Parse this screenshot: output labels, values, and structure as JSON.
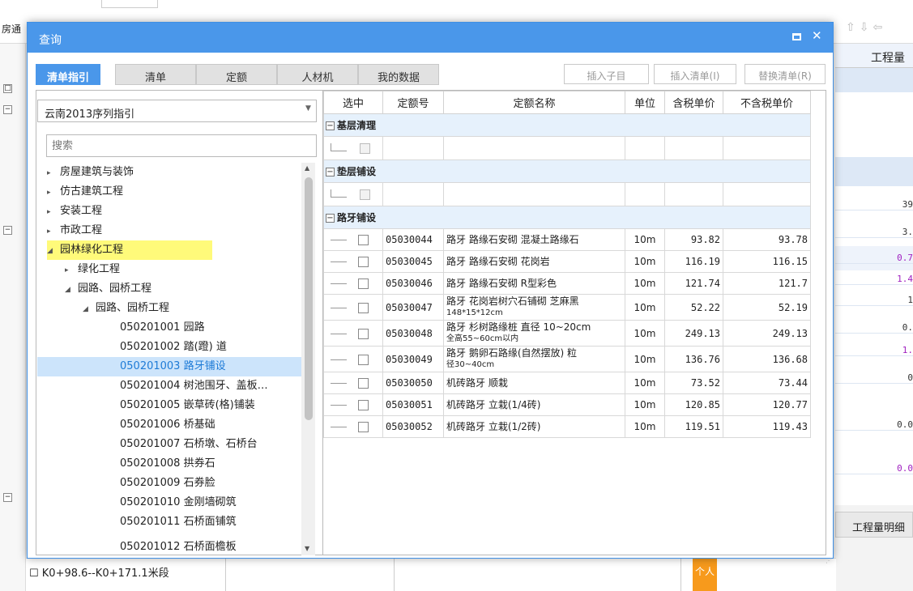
{
  "background": {
    "left_label": "房通",
    "right_header": "工程量",
    "right_values": [
      "39",
      "3.",
      "0.7",
      "1.4",
      "1",
      "0.",
      "1.",
      "0",
      "0.0",
      "0.0"
    ],
    "detail_tab": "工程量明细",
    "bottom_text": "☐ K0+98.6--K0+171.1米段",
    "orange_text": "个人"
  },
  "dialog": {
    "title": "查询",
    "tabs": [
      "清单指引",
      "清单",
      "定额",
      "人材机",
      "我的数据"
    ],
    "toolbar": {
      "insert_child": "插入子目",
      "insert_list": "插入清单(I)",
      "replace_list": "替换清单(R)"
    }
  },
  "left": {
    "index_select": "云南2013序列指引",
    "search_placeholder": "搜索",
    "tree": [
      {
        "label": "房屋建筑与装饰",
        "caret": "▸"
      },
      {
        "label": "仿古建筑工程",
        "caret": "▸"
      },
      {
        "label": "安装工程",
        "caret": "▸"
      },
      {
        "label": "市政工程",
        "caret": "▸"
      },
      {
        "label": "园林绿化工程",
        "caret": "◢"
      },
      {
        "label": "绿化工程",
        "caret": "▸"
      },
      {
        "label": "园路、园桥工程",
        "caret": "◢"
      },
      {
        "label": "园路、园桥工程",
        "caret": "◢"
      },
      {
        "label": "050201001  园路",
        "caret": ""
      },
      {
        "label": "050201002  踏(蹬) 道",
        "caret": ""
      },
      {
        "label": "050201003  路牙铺设",
        "caret": ""
      },
      {
        "label": "050201004  树池围牙、盖板…",
        "caret": ""
      },
      {
        "label": "050201005  嵌草砖(格)铺装",
        "caret": ""
      },
      {
        "label": "050201006  桥基础",
        "caret": ""
      },
      {
        "label": "050201007  石桥墩、石桥台",
        "caret": ""
      },
      {
        "label": "050201008  拱券石",
        "caret": ""
      },
      {
        "label": "050201009  石券脸",
        "caret": ""
      },
      {
        "label": "050201010  金刚墙砌筑",
        "caret": ""
      },
      {
        "label": "050201011  石桥面铺筑",
        "caret": ""
      },
      {
        "label": "050201012  石桥面檐板",
        "caret": ""
      }
    ]
  },
  "grid": {
    "headers": [
      "选中",
      "定额号",
      "定额名称",
      "单位",
      "含税单价",
      "不含税单价"
    ],
    "groups": [
      {
        "title": "基层清理",
        "items": []
      },
      {
        "title": "垫层铺设",
        "items": []
      },
      {
        "title": "路牙铺设",
        "items": [
          {
            "code": "05030044",
            "name": "路牙 路缘石安砌 混凝土路缘石",
            "name2": "",
            "unit": "10m",
            "tax": "93.82",
            "notax": "93.78"
          },
          {
            "code": "05030045",
            "name": "路牙 路缘石安砌 花岗岩",
            "name2": "",
            "unit": "10m",
            "tax": "116.19",
            "notax": "116.15"
          },
          {
            "code": "05030046",
            "name": "路牙 路缘石安砌 R型彩色",
            "name2": "",
            "unit": "10m",
            "tax": "121.74",
            "notax": "121.7"
          },
          {
            "code": "05030047",
            "name": "路牙 花岗岩树穴石铺砌 芝麻黑",
            "name2": "148*15*12cm",
            "unit": "10m",
            "tax": "52.22",
            "notax": "52.19"
          },
          {
            "code": "05030048",
            "name": "路牙 杉树路缘桩 直径 10~20cm",
            "name2": "全高55~60cm以内",
            "unit": "10m",
            "tax": "249.13",
            "notax": "249.13"
          },
          {
            "code": "05030049",
            "name": "路牙 鹅卵石路缘(自然摆放) 粒",
            "name2": "径30~40cm",
            "unit": "10m",
            "tax": "136.76",
            "notax": "136.68"
          },
          {
            "code": "05030050",
            "name": "机砖路牙 顺栽",
            "name2": "",
            "unit": "10m",
            "tax": "73.52",
            "notax": "73.44"
          },
          {
            "code": "05030051",
            "name": "机砖路牙 立栽(1/4砖)",
            "name2": "",
            "unit": "10m",
            "tax": "120.85",
            "notax": "120.77"
          },
          {
            "code": "05030052",
            "name": "机砖路牙 立栽(1/2砖)",
            "name2": "",
            "unit": "10m",
            "tax": "119.51",
            "notax": "119.43"
          }
        ]
      }
    ]
  }
}
